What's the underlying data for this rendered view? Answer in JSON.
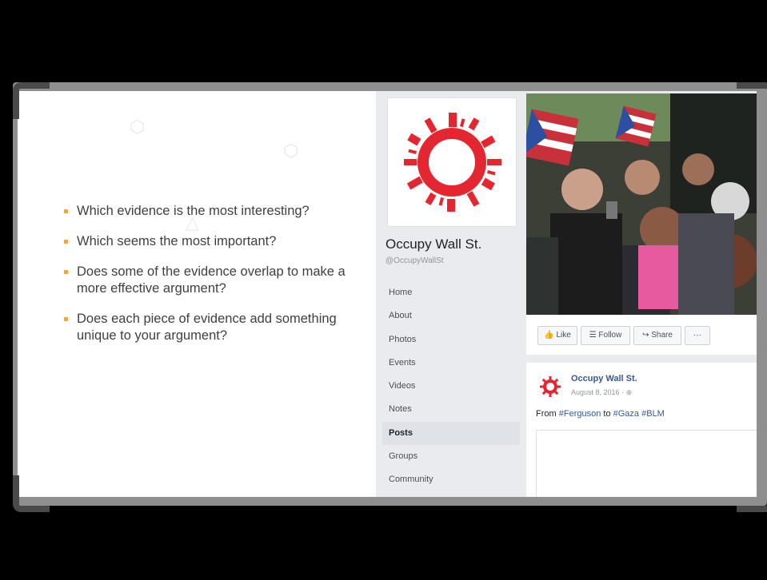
{
  "slide": {
    "questions": [
      "Which evidence is the most interesting?",
      "Which seems the most important?",
      "Does some of the evidence overlap to make a more effective argument?",
      "Does each piece of evidence add something unique to your argument?"
    ]
  },
  "facebook": {
    "page_name": "Occupy Wall St.",
    "page_handle": "@OccupyWallSt",
    "nav": [
      "Home",
      "About",
      "Photos",
      "Events",
      "Videos",
      "Notes",
      "Posts",
      "Groups",
      "Community"
    ],
    "active_nav": "Posts",
    "actions": {
      "like": "Like",
      "follow": "Follow",
      "share": "Share",
      "more": "···"
    },
    "post": {
      "author": "Occupy Wall St.",
      "date": "August 8, 2016 ·",
      "text_prefix": "From ",
      "tag1": "#Ferguson",
      "text_mid": " to ",
      "tag2": "#Gaza",
      "tag3": "#BLM"
    }
  },
  "colors": {
    "accent_bullet": "#f2a33a",
    "logo_red": "#e3262f",
    "fb_link": "#365899"
  }
}
